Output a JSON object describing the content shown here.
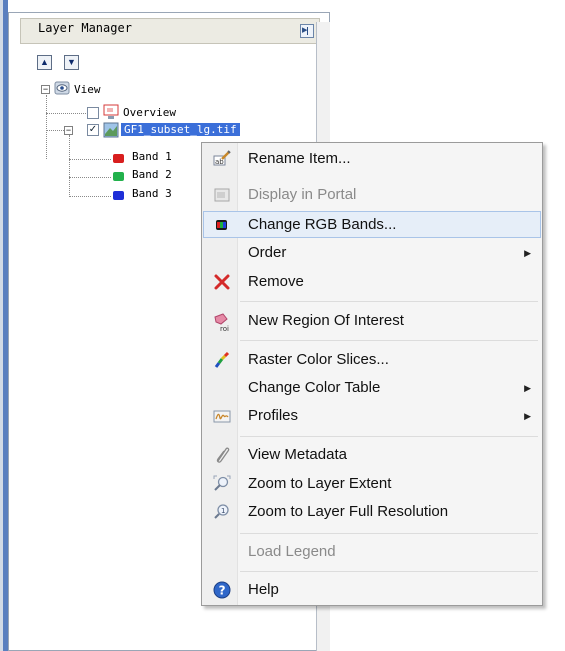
{
  "panel": {
    "title": "Layer Manager"
  },
  "tree": {
    "view": "View",
    "overview": "Overview",
    "layer": "GF1_subset_lg.tif",
    "bands": [
      {
        "label": "Band 1",
        "color": "#d81e1e"
      },
      {
        "label": "Band 2",
        "color": "#22b14c"
      },
      {
        "label": "Band 3",
        "color": "#1e2fd8"
      }
    ]
  },
  "menu": {
    "items": [
      {
        "label": "Rename Item...",
        "icon": "rename-icon"
      },
      {
        "label": "Display in Portal",
        "icon": "portal-icon",
        "disabled": true
      },
      {
        "label": "Change RGB Bands...",
        "icon": "rgb-bands-icon",
        "highlighted": true
      },
      {
        "label": "Order",
        "submenu": true
      },
      {
        "label": "Remove",
        "icon": "remove-icon"
      },
      {
        "label": "New Region Of Interest",
        "icon": "roi-icon"
      },
      {
        "label": "Raster Color Slices...",
        "icon": "color-slices-icon"
      },
      {
        "label": "Change Color Table",
        "submenu": true
      },
      {
        "label": "Profiles",
        "icon": "profiles-icon",
        "submenu": true
      },
      {
        "label": "View Metadata",
        "icon": "metadata-icon"
      },
      {
        "label": "Zoom to Layer Extent",
        "icon": "zoom-extent-icon"
      },
      {
        "label": "Zoom to Layer Full Resolution",
        "icon": "zoom-full-resolution-icon"
      },
      {
        "label": "Load Legend",
        "disabled": true
      },
      {
        "label": "Help",
        "icon": "help-icon"
      }
    ]
  },
  "colors": {
    "selection": "#3b6fd9",
    "highlight": "#e6eef8",
    "disabled": "#8a8a8a"
  }
}
